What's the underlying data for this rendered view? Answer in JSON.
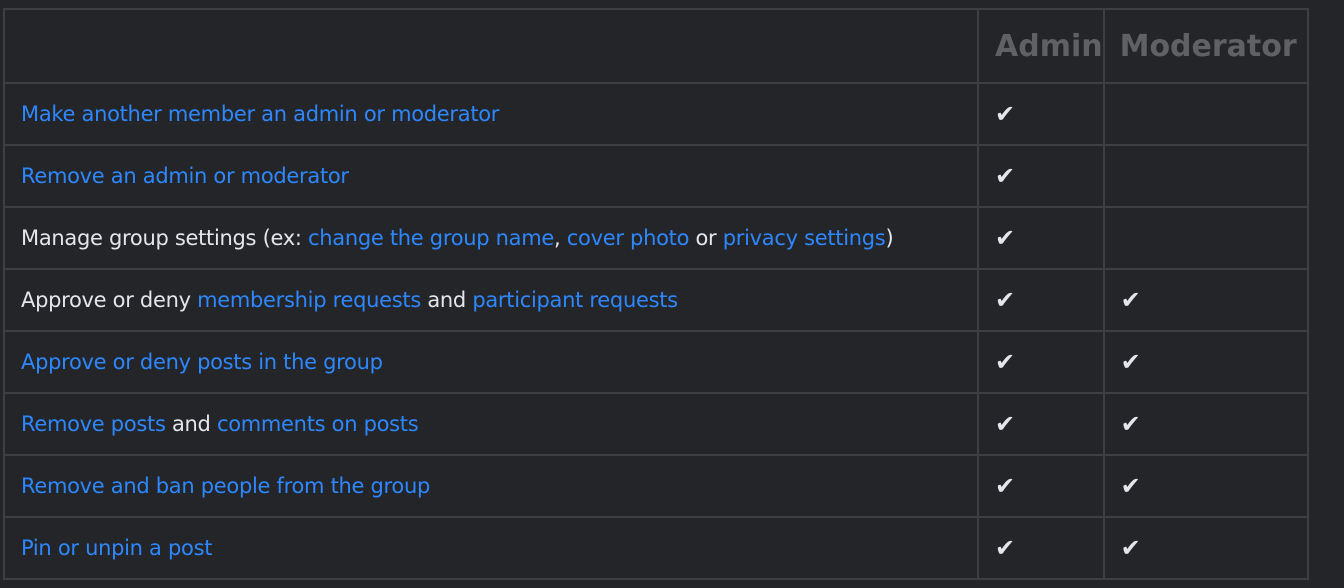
{
  "table": {
    "headers": {
      "description": "",
      "admin": "Admin",
      "moderator": "Moderator"
    },
    "check_icon": "✔",
    "colors": {
      "link": "#2d88ff",
      "text": "#e4e6eb",
      "header": "#606164",
      "background": "#242528",
      "border": "#3e3f42"
    },
    "rows": [
      {
        "segments": [
          {
            "text": "Make another member an admin or moderator",
            "link": true
          }
        ],
        "admin": true,
        "moderator": false
      },
      {
        "segments": [
          {
            "text": "Remove an admin or moderator",
            "link": true
          }
        ],
        "admin": true,
        "moderator": false
      },
      {
        "segments": [
          {
            "text": "Manage group settings (ex: ",
            "link": false
          },
          {
            "text": "change the group name",
            "link": true
          },
          {
            "text": ", ",
            "link": false
          },
          {
            "text": "cover photo",
            "link": true
          },
          {
            "text": " or ",
            "link": false
          },
          {
            "text": "privacy settings",
            "link": true
          },
          {
            "text": ")",
            "link": false
          }
        ],
        "admin": true,
        "moderator": false
      },
      {
        "segments": [
          {
            "text": "Approve or deny ",
            "link": false
          },
          {
            "text": "membership requests",
            "link": true
          },
          {
            "text": " and ",
            "link": false
          },
          {
            "text": "participant requests",
            "link": true
          }
        ],
        "admin": true,
        "moderator": true
      },
      {
        "segments": [
          {
            "text": "Approve or deny posts in the group",
            "link": true
          }
        ],
        "admin": true,
        "moderator": true
      },
      {
        "segments": [
          {
            "text": "Remove posts",
            "link": true
          },
          {
            "text": " and ",
            "link": false
          },
          {
            "text": "comments on posts",
            "link": true
          }
        ],
        "admin": true,
        "moderator": true
      },
      {
        "segments": [
          {
            "text": "Remove and ban people from the group",
            "link": true
          }
        ],
        "admin": true,
        "moderator": true
      },
      {
        "segments": [
          {
            "text": "Pin or unpin a post",
            "link": true
          }
        ],
        "admin": true,
        "moderator": true
      }
    ]
  }
}
